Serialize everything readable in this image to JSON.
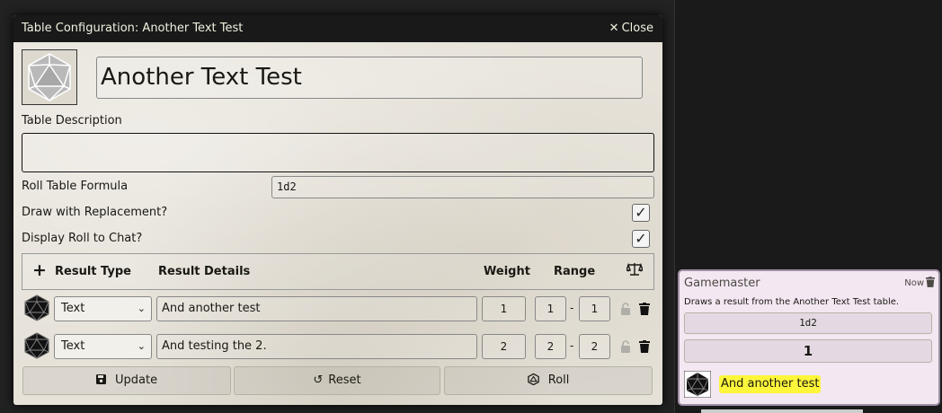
{
  "dialog": {
    "title": "Table Configuration: Another Text Test",
    "close_label": "Close",
    "table_name": "Another Text Test",
    "description_label": "Table Description",
    "description_value": "",
    "formula_label": "Roll Table Formula",
    "formula_value": "1d2",
    "replacement_label": "Draw with Replacement?",
    "replacement_checked": true,
    "display_roll_label": "Display Roll to Chat?",
    "display_roll_checked": true,
    "results_header": {
      "add_icon": "plus-icon",
      "type": "Result Type",
      "details": "Result Details",
      "weight": "Weight",
      "range": "Range",
      "normalize_icon": "balance-scale-icon"
    },
    "results": [
      {
        "type": "Text",
        "details": "And another test",
        "weight": "1",
        "range_low": "1",
        "range_high": "1"
      },
      {
        "type": "Text",
        "details": "And testing the 2.",
        "weight": "2",
        "range_low": "2",
        "range_high": "2"
      }
    ],
    "buttons": {
      "update": "Update",
      "reset": "Reset",
      "roll": "Roll"
    }
  },
  "chat": {
    "sender": "Gamemaster",
    "time": "Now",
    "flavor": "Draws a result from the Another Text Test table.",
    "formula": "1d2",
    "total": "1",
    "result_text": "And another test",
    "highlight_color": "#fdf63a"
  }
}
